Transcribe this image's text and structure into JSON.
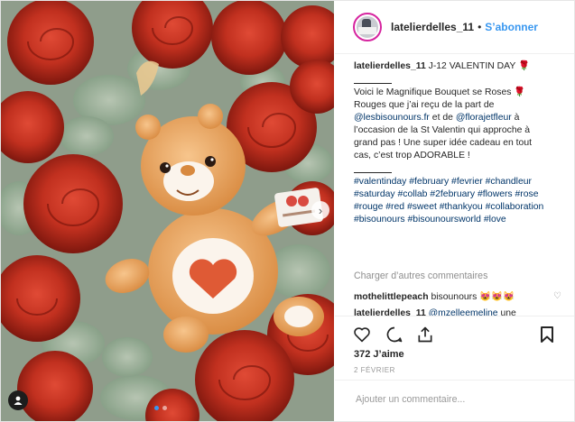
{
  "post": {
    "username": "latelierdelles_11",
    "follow_label": "S’abonner",
    "bullet": "•"
  },
  "caption": {
    "username": "latelierdelles_11",
    "title": "J-12 VALENTIN DAY 🌹",
    "line1": "Voici le Magnifique Bouquet se Roses 🌹",
    "line2": "Rouges que j’ai reçu de la part de",
    "mention1": "@lesbisounours.fr",
    "line3_mid": "et de",
    "mention2": "@florajetfleur",
    "line3_end": "à",
    "line4": "l’occasion de la St Valentin qui approche à",
    "line5": "grand pas ! Une super idée cadeau en tout",
    "line6": "cas, c’est trop ADORABLE !",
    "hashtags": [
      "#valentinday",
      "#february",
      "#fevrier",
      "#chandleur",
      "#saturday",
      "#collab",
      "#2february",
      "#flowers",
      "#rose",
      "#rouge",
      "#red",
      "#sweet",
      "#thankyou",
      "#collaboration",
      "#bisounours",
      "#bisounoursworld",
      "#love"
    ]
  },
  "load_more": "Charger d’autres commentaires",
  "comment1": {
    "user": "mothelittlepeach",
    "text": "bisounours 😻😻😻"
  },
  "comment2": {
    "user": "latelierdelles_11",
    "mention": "@mzelleemeline",
    "text": "une"
  },
  "likes": "372 J’aime",
  "date": "2 FÉVRIER",
  "add_comment_placeholder": "Ajouter un commentaire...",
  "icons": {
    "like": "heart-icon",
    "comment": "comment-icon",
    "share": "share-icon",
    "save": "bookmark-icon",
    "user_tag": "user-tag-icon",
    "next": "chevron-right-icon"
  },
  "colors": {
    "link": "#3897f0",
    "hashtag": "#003569",
    "muted": "#8e8e8e",
    "text": "#262626"
  }
}
